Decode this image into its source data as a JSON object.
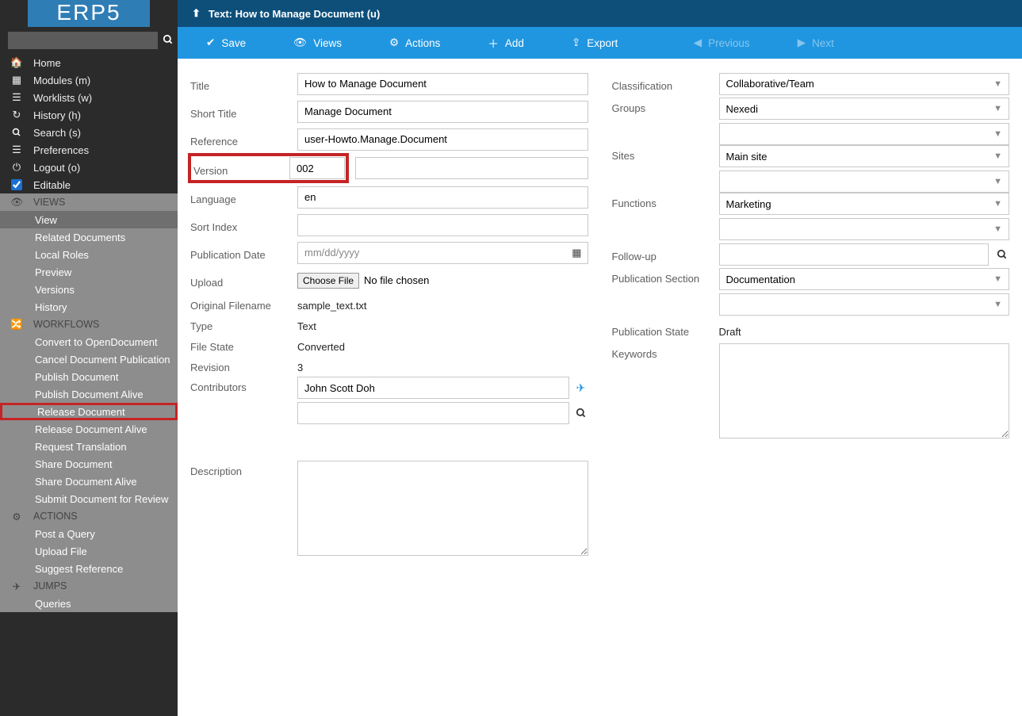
{
  "logo": "ERP5",
  "breadcrumb": "Text: How to Manage Document (u)",
  "toolbar": {
    "save": "Save",
    "views": "Views",
    "actions": "Actions",
    "add": "Add",
    "export": "Export",
    "previous": "Previous",
    "next": "Next"
  },
  "sidebar": {
    "search_placeholder": "",
    "main": [
      "Home",
      "Modules (m)",
      "Worklists (w)",
      "History (h)",
      "Search (s)",
      "Preferences",
      "Logout (o)"
    ],
    "editable_label": "Editable",
    "views_header": "VIEWS",
    "views": [
      "View",
      "Related Documents",
      "Local Roles",
      "Preview",
      "Versions",
      "History"
    ],
    "workflows_header": "WORKFLOWS",
    "workflows": [
      "Convert to OpenDocument",
      "Cancel Document Publication",
      "Publish Document",
      "Publish Document Alive",
      "Release Document",
      "Release Document Alive",
      "Request Translation",
      "Share Document",
      "Share Document Alive",
      "Submit Document for Review"
    ],
    "actions_header": "ACTIONS",
    "actions": [
      "Post a Query",
      "Upload File",
      "Suggest Reference"
    ],
    "jumps_header": "JUMPS",
    "jumps": [
      "Queries"
    ]
  },
  "form": {
    "labels": {
      "title": "Title",
      "short_title": "Short Title",
      "reference": "Reference",
      "version": "Version",
      "language": "Language",
      "sort_index": "Sort Index",
      "publication_date": "Publication Date",
      "upload": "Upload",
      "original_filename": "Original Filename",
      "type": "Type",
      "file_state": "File State",
      "revision": "Revision",
      "contributors": "Contributors",
      "description": "Description",
      "classification": "Classification",
      "groups": "Groups",
      "sites": "Sites",
      "functions": "Functions",
      "follow_up": "Follow-up",
      "publication_section": "Publication Section",
      "publication_state": "Publication State",
      "keywords": "Keywords"
    },
    "values": {
      "title": "How to Manage Document",
      "short_title": "Manage Document",
      "reference": "user-Howto.Manage.Document",
      "version": "002",
      "language": "en",
      "sort_index": "",
      "publication_date": "mm/dd/yyyy",
      "upload_btn": "Choose File",
      "upload_status": "No file chosen",
      "original_filename": "sample_text.txt",
      "type": "Text",
      "file_state": "Converted",
      "revision": "3",
      "contributor1": "John Scott Doh",
      "contributor2": "",
      "description": "",
      "classification": "Collaborative/Team",
      "groups": "Nexedi",
      "sites": "Main site",
      "functions": "Marketing",
      "follow_up": "",
      "publication_section": "Documentation",
      "publication_state": "Draft",
      "keywords": ""
    }
  }
}
